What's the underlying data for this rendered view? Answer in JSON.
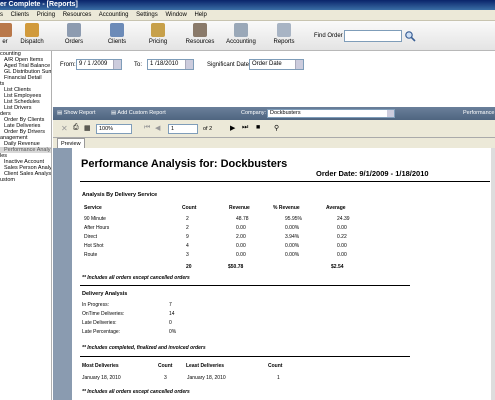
{
  "window": {
    "title": "er Complete - [Reports]"
  },
  "menu": [
    "s",
    "Clients",
    "Pricing",
    "Resources",
    "Accounting",
    "Settings",
    "Window",
    "Help"
  ],
  "toolbar": {
    "buttons": [
      "er",
      "Dispatch",
      "Orders",
      "Clients",
      "Pricing",
      "Resources",
      "Accounting",
      "Reports"
    ],
    "find_label": "Find Order"
  },
  "sidebar": [
    "counting",
    "A/R Open Items",
    "Aged Trial Balance",
    "GL Distribution Sum",
    "Financial Detail",
    "ts",
    "List Clients",
    "List Employees",
    "List Schedules",
    "List Drivers",
    "ders",
    "Order By Clients",
    "Late Deliveries",
    "Order By Drivers",
    "anagement",
    "Daily Revenue",
    "Performance Analy",
    "les",
    "Inactive Account",
    "Sales Person Analy",
    "Client Sales Analys",
    "ustom"
  ],
  "filters": {
    "from_label": "From:",
    "from": "9 / 1 /2009",
    "to_label": "To:",
    "to": "1 /18/2010",
    "sig_label": "Significant Date:",
    "sig": "Order Date"
  },
  "reportbar": {
    "show": "Show Report",
    "add": "Add Custom Report",
    "company_label": "Company:",
    "company": "Dockbusters",
    "perf": "Performance"
  },
  "nav": {
    "zoom": "100%",
    "page": "1",
    "of": "of 2"
  },
  "preview_tab": "Preview",
  "report": {
    "title": "Performance Analysis for:  Dockbusters",
    "order_date": "Order Date: 9/1/2009 - 1/18/2010",
    "section1": "Analysis By Delivery Service",
    "headers": [
      "Service",
      "Count",
      "Revenue",
      "% Revenue",
      "Average"
    ],
    "rows": [
      [
        "90 Minute",
        "2",
        "48.78",
        "95.95%",
        "24.39"
      ],
      [
        "After Hours",
        "2",
        "0.00",
        "0.00%",
        "0.00"
      ],
      [
        "Direct",
        "9",
        "2.00",
        "3.94%",
        "0.22"
      ],
      [
        "Hot Shot",
        "4",
        "0.00",
        "0.00%",
        "0.00"
      ],
      [
        "Route",
        "3",
        "0.00",
        "0.00%",
        "0.00"
      ]
    ],
    "totals": [
      "20",
      "$50.78",
      "$2.54"
    ],
    "note1": "** Includes all orders except cancelled orders",
    "section2": "Delivery Analysis",
    "delivery": [
      [
        "In Progress:",
        "7"
      ],
      [
        "OnTime Deliveries:",
        "14"
      ],
      [
        "Late Deliveries:",
        "0"
      ],
      [
        "Late Percentage:",
        "0%"
      ]
    ],
    "note2": "** Includes completed, finalized and invoiced orders",
    "most_header": [
      "Most Deliveries",
      "Count",
      "Least Deliveries",
      "Count"
    ],
    "most_row": [
      "January 18, 2010",
      "3",
      "January 18, 2010",
      "1"
    ],
    "note3": "** Includes all orders except cancelled orders"
  }
}
